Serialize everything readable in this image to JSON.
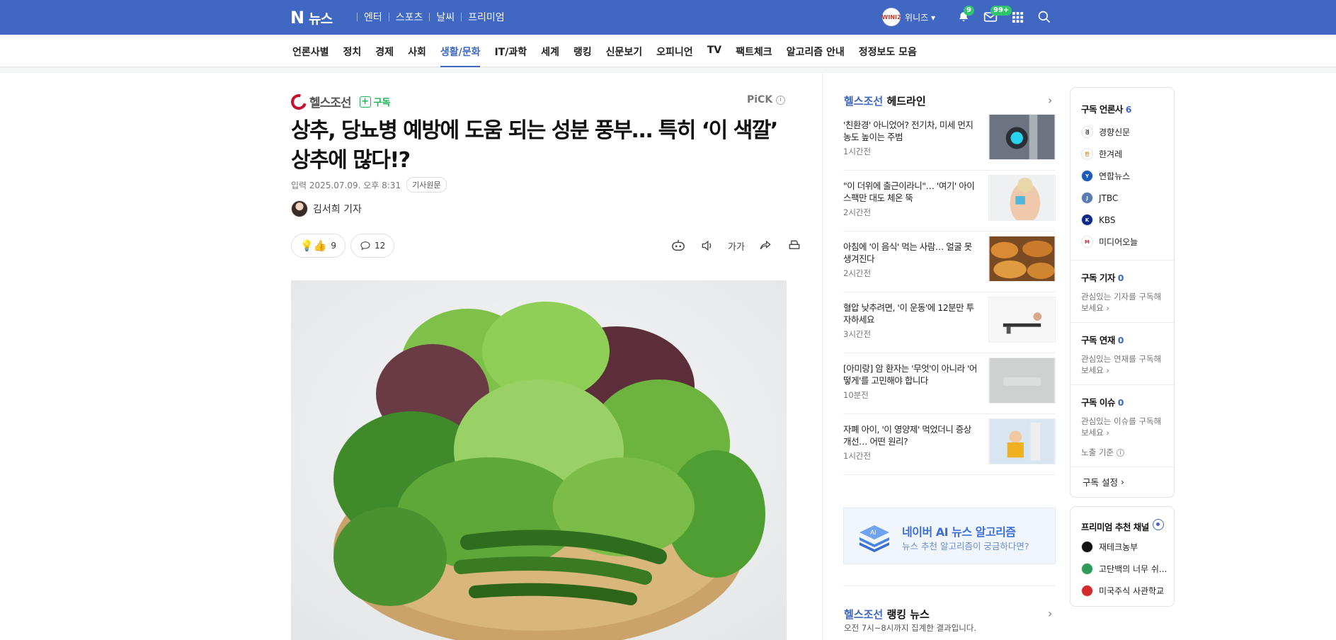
{
  "header": {
    "logo_n": "N",
    "logo_text": "뉴스",
    "top_nav": [
      "엔터",
      "스포츠",
      "날씨",
      "프리미엄"
    ],
    "avatar_text": "WINI2",
    "username": "위니즈",
    "notif_count": "9",
    "mail_count": "99+"
  },
  "categories": [
    "언론사별",
    "정치",
    "경제",
    "사회",
    "생활/문화",
    "IT/과학",
    "세계",
    "랭킹",
    "신문보기",
    "오피니언",
    "TV",
    "팩트체크",
    "알고리즘 안내",
    "정정보도 모음"
  ],
  "active_category": "생활/문화",
  "article": {
    "press": "헬스조선",
    "subscribe": "구독",
    "pick": "PiCK",
    "pick_info": "i",
    "title": "상추, 당뇨병 예방에 도움 되는 성분 풍부… 특히 ‘이 색깔’ 상추에 많다!?",
    "date": "입력 2025.07.09. 오후 8:31",
    "original": "기사원문",
    "reporter": "김서희 기자",
    "reaction_count": "9",
    "comment_count": "12",
    "font_tool": "가가"
  },
  "headline": {
    "press": "헬스조선",
    "title": "헤드라인",
    "items": [
      {
        "text": "'친환경' 아니었어? 전기차, 미세 먼지 농도 높이는 주범",
        "time": "1시간전"
      },
      {
        "text": "\"이 더위에 출근이라니\"… '여기' 아이스팩만 대도 체온 뚝",
        "time": "2시간전"
      },
      {
        "text": "아침에 '이 음식' 먹는 사람… 얼굴 못 생겨진다",
        "time": "2시간전"
      },
      {
        "text": "혈압 낮추려면, '이 운동'에 12분만 투자하세요",
        "time": "3시간전"
      },
      {
        "text": "[아미랑] 암 환자는 '무엇'이 아니라 '어떻게'를 고민해야 합니다",
        "time": "10분전"
      },
      {
        "text": "자폐 아이, '이 영양제' 먹었더니 증상 개선… 어떤 원리?",
        "time": "1시간전"
      }
    ],
    "ai_title": "네이버 AI 뉴스 알고리즘",
    "ai_sub": "뉴스 추천 알고리즘이 궁금하다면?",
    "ai_icon_label": "AI",
    "ranking_press": "헬스조선",
    "ranking_title": "랭킹 뉴스",
    "ranking_sub": "오전 7시~8시까지 집계한 결과입니다."
  },
  "sidebar": {
    "sub_press_label": "구독 언론사",
    "sub_press_count": "6",
    "presses": [
      {
        "name": "경향신문",
        "color": "#ffffff",
        "fg": "#333333",
        "mark": "경"
      },
      {
        "name": "한겨레",
        "color": "#ffffff",
        "fg": "#e08a00",
        "mark": "한"
      },
      {
        "name": "연합뉴스",
        "color": "#1a5ab8",
        "fg": "#ffffff",
        "mark": "Y"
      },
      {
        "name": "JTBC",
        "color": "#5a7bb4",
        "fg": "#ffffff",
        "mark": "J"
      },
      {
        "name": "KBS",
        "color": "#0a2a8a",
        "fg": "#ffffff",
        "mark": "K"
      },
      {
        "name": "미디어오늘",
        "color": "#ffffff",
        "fg": "#d22b2b",
        "mark": "M"
      }
    ],
    "reporter_label": "구독 기자",
    "reporter_count": "0",
    "reporter_desc": "관심있는 기자를 구독해보세요",
    "series_label": "구독 연재",
    "series_count": "0",
    "series_desc": "관심있는 연재를 구독해보세요",
    "issue_label": "구독 이슈",
    "issue_count": "0",
    "issue_desc": "관심있는 이슈를 구독해보세요",
    "exposure": "노출 기준",
    "setting": "구독 설정",
    "premium_title": "프리미엄 추천 채널",
    "premium": [
      {
        "name": "재테크농부",
        "color": "#111111"
      },
      {
        "name": "고단백의 너무 쉬...",
        "color": "#2e9b5a"
      },
      {
        "name": "미국주식 사관학교",
        "color": "#d22b2b"
      }
    ]
  },
  "colors": {
    "brand": "#4068c2",
    "green": "#19b455",
    "badge": "#2fc56d"
  }
}
